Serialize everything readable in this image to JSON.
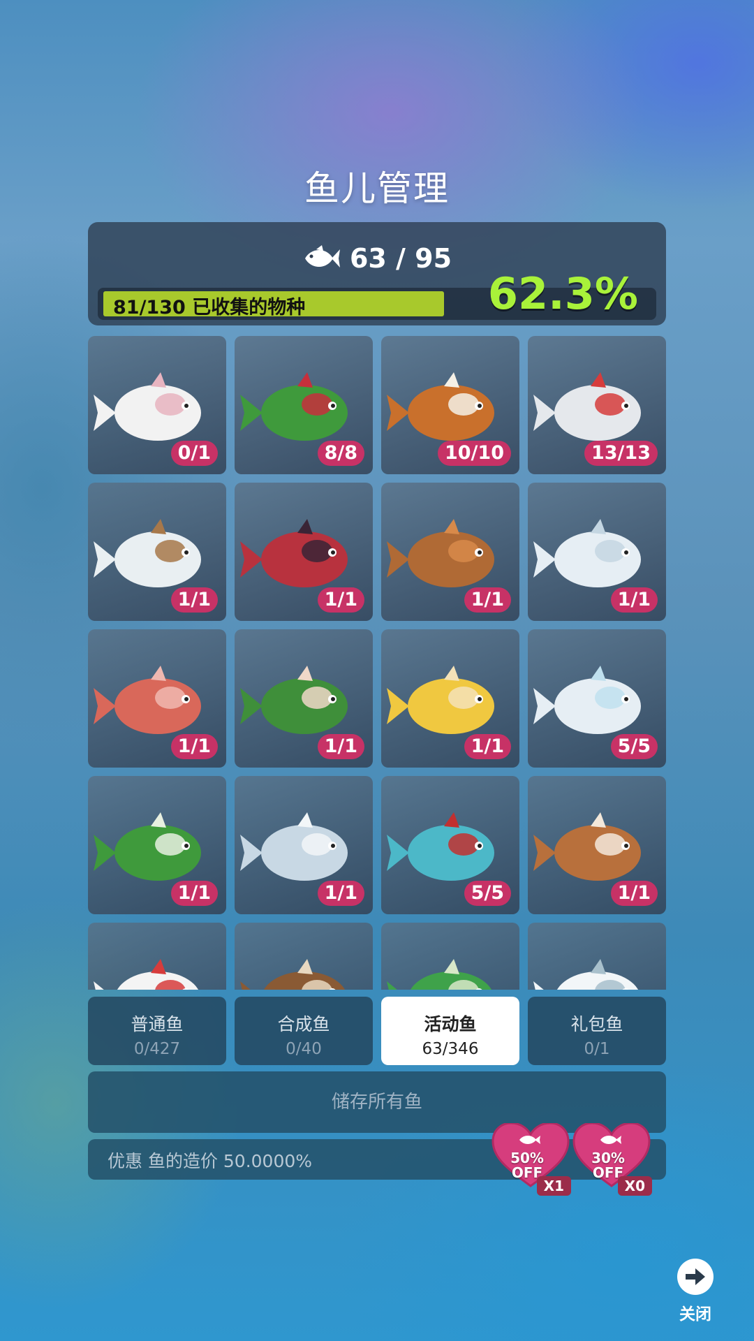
{
  "title": "鱼儿管理",
  "stats": {
    "fish_count": "63 / 95",
    "collected_label": "81/130 已收集的物种",
    "collected_fraction": 0.623,
    "percent": "62.3%"
  },
  "fish_cards": [
    {
      "icon": "axolotl-crown-icon",
      "count": "0/1"
    },
    {
      "icon": "holly-fish-icon",
      "count": "8/8"
    },
    {
      "icon": "reindeer-fish-icon",
      "count": "10/10"
    },
    {
      "icon": "snowman-angelfish-icon",
      "count": "13/13"
    },
    {
      "icon": "snow-tree-fish-icon",
      "count": "1/1"
    },
    {
      "icon": "clownfish-hat-icon",
      "count": "1/1"
    },
    {
      "icon": "reindeer-pufferfish-icon",
      "count": "1/1"
    },
    {
      "icon": "snowball-fish-icon",
      "count": "1/1"
    },
    {
      "icon": "stocking-pig-icon",
      "count": "1/1"
    },
    {
      "icon": "holly-seadragon-icon",
      "count": "1/1"
    },
    {
      "icon": "bell-squid-icon",
      "count": "1/1"
    },
    {
      "icon": "snowflake-whale-icon",
      "count": "5/5"
    },
    {
      "icon": "holly-swordfish-icon",
      "count": "1/1"
    },
    {
      "icon": "ice-jellyfish-icon",
      "count": "1/1"
    },
    {
      "icon": "snowglobe-turtle-icon",
      "count": "5/5"
    },
    {
      "icon": "reindeer-dolphin-icon",
      "count": "1/1"
    },
    {
      "icon": "scarf-narwhal-icon",
      "count": ""
    },
    {
      "icon": "reindeer-ray-icon",
      "count": ""
    },
    {
      "icon": "holly-shark-icon",
      "count": ""
    },
    {
      "icon": "snowy-reef-icon",
      "count": ""
    }
  ],
  "tabs": [
    {
      "label": "普通鱼",
      "count": "0/427",
      "active": false
    },
    {
      "label": "合成鱼",
      "count": "0/40",
      "active": false
    },
    {
      "label": "活动鱼",
      "count": "63/346",
      "active": true
    },
    {
      "label": "礼包鱼",
      "count": "0/1",
      "active": false
    }
  ],
  "store_all_label": "储存所有鱼",
  "discount_text": "优惠 鱼的造价 50.0000%",
  "coupons": [
    {
      "percent": "50%",
      "off": "OFF",
      "qty": "X1"
    },
    {
      "percent": "30%",
      "off": "OFF",
      "qty": "X0"
    }
  ],
  "close_label": "关闭",
  "colors": {
    "progress_fill": "#a8c92c",
    "percent_text": "#a9f23a",
    "badge": "#c73266",
    "coupon": "#d63d7d"
  }
}
